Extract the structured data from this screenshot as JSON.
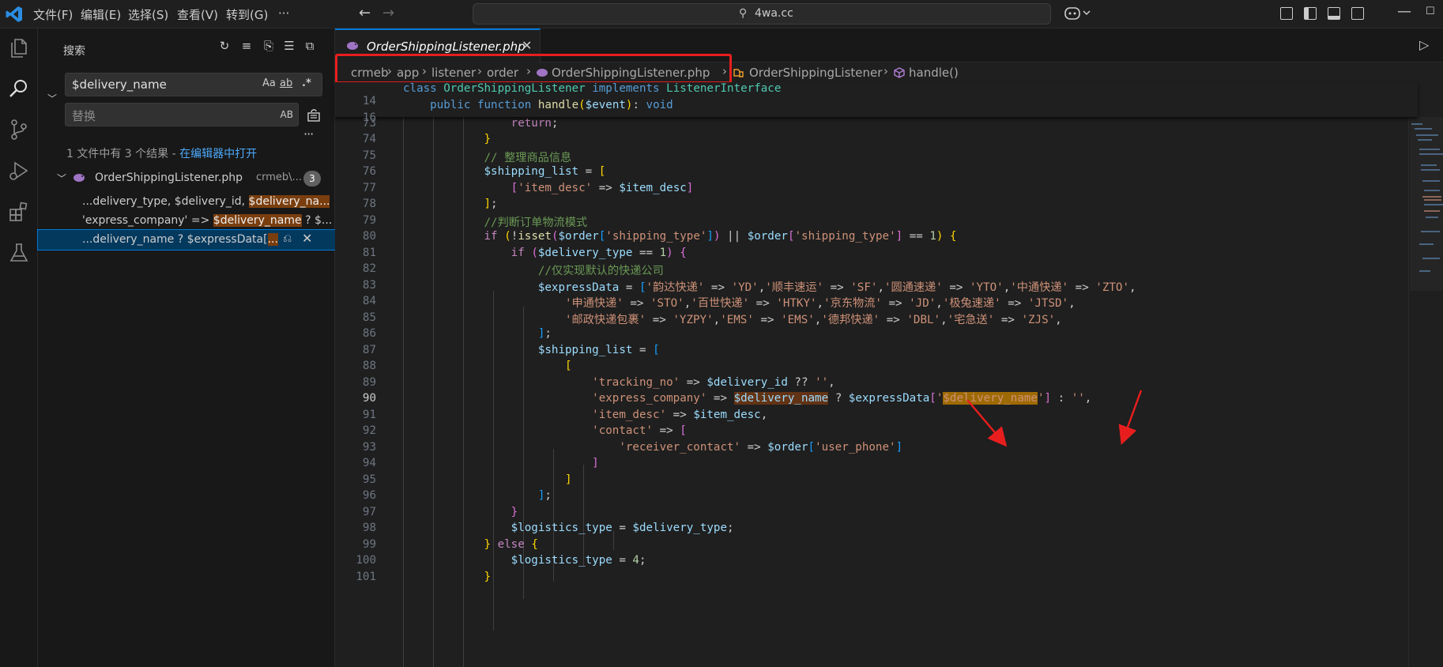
{
  "titlebar": {
    "menus": [
      "文件(F)",
      "编辑(E)",
      "选择(S)",
      "查看(V)",
      "转到(G)",
      "···"
    ],
    "command_center": "4wa.cc"
  },
  "sidebar": {
    "title": "搜索",
    "search_value": "$delivery_name",
    "replace_placeholder": "替换",
    "opt_case": "Aa",
    "opt_word": "ab",
    "opt_regex": ".*",
    "opt_preserve_case": "AB",
    "result_summary": "1 文件中有 3 个结果 - ",
    "open_in_editor": "在编辑器中打开",
    "file": {
      "name": "OrderShippingListener.php",
      "path": "crmeb\\...",
      "count": "3"
    },
    "matches": [
      {
        "pre": "...delivery_type, $delivery_id, ",
        "hit": "$delivery_na..."
      },
      {
        "pre": "'express_company' => ",
        "hit": "$delivery_name",
        "post": " ? $..."
      },
      {
        "pre": "...delivery_name ? $expressData[",
        "hit": "..."
      }
    ]
  },
  "editor": {
    "tab_label": "OrderShippingListener.php",
    "breadcrumb": [
      "crmeb",
      "app",
      "listener",
      "order",
      "OrderShippingListener.php",
      "OrderShippingListener",
      "handle()"
    ]
  },
  "code": {
    "sticky": [
      {
        "ln": "14",
        "text": "class OrderShippingListener implements ListenerInterface"
      },
      {
        "ln": "16",
        "text": "    public function handle($event): void"
      }
    ],
    "lines": [
      {
        "ln": "73",
        "text": "                return;"
      },
      {
        "ln": "74",
        "text": "            }"
      },
      {
        "ln": "75",
        "text": "            // 整理商品信息"
      },
      {
        "ln": "76",
        "text": "            $shipping_list = ["
      },
      {
        "ln": "77",
        "text": "                ['item_desc' => $item_desc]"
      },
      {
        "ln": "78",
        "text": "            ];"
      },
      {
        "ln": "79",
        "text": "            //判断订单物流模式"
      },
      {
        "ln": "80",
        "text": "            if (!isset($order['shipping_type']) || $order['shipping_type'] == 1) {"
      },
      {
        "ln": "81",
        "text": "                if ($delivery_type == 1) {"
      },
      {
        "ln": "82",
        "text": "                    //仅实现默认的快递公司"
      },
      {
        "ln": "83",
        "text": "                    $expressData = ['韵达快递' => 'YD','顺丰速运' => 'SF','圆通速递' => 'YTO','中通快递' => 'ZTO',"
      },
      {
        "ln": "84",
        "text": "                        '申通快递' => 'STO','百世快递' => 'HTKY','京东物流' => 'JD','极兔速递' => 'JTSD',"
      },
      {
        "ln": "85",
        "text": "                        '邮政快递包裹' => 'YZPY','EMS' => 'EMS','德邦快递' => 'DBL','宅急送' => 'ZJS',"
      },
      {
        "ln": "86",
        "text": "                    ];"
      },
      {
        "ln": "87",
        "text": "                    $shipping_list = ["
      },
      {
        "ln": "88",
        "text": "                        ["
      },
      {
        "ln": "89",
        "text": "                            'tracking_no' => $delivery_id ?? '',"
      },
      {
        "ln": "90",
        "text": "                            'express_company' => $delivery_name ? $expressData['$delivery_name'] : '',"
      },
      {
        "ln": "91",
        "text": "                            'item_desc' => $item_desc,"
      },
      {
        "ln": "92",
        "text": "                            'contact' => ["
      },
      {
        "ln": "93",
        "text": "                                'receiver_contact' => $order['user_phone']"
      },
      {
        "ln": "94",
        "text": "                            ]"
      },
      {
        "ln": "95",
        "text": "                        ]"
      },
      {
        "ln": "96",
        "text": "                    ];"
      },
      {
        "ln": "97",
        "text": "                }"
      },
      {
        "ln": "98",
        "text": "                $logistics_type = $delivery_type;"
      },
      {
        "ln": "99",
        "text": "            } else {"
      },
      {
        "ln": "100",
        "text": "                $logistics_type = 4;"
      },
      {
        "ln": "101",
        "text": "            }"
      }
    ]
  },
  "colors": {
    "accent": "#0078d4",
    "annotation_red": "#e81e1e",
    "match_highlight": "#9e6a03"
  },
  "icons": [
    "vscode-logo-icon",
    "explorer-icon",
    "search-icon",
    "source-control-icon",
    "run-debug-icon",
    "extensions-icon",
    "testing-icon",
    "php-elephant-icon",
    "refresh-icon",
    "clear-icon",
    "new-search-editor-icon",
    "collapse-icon",
    "expand-icon",
    "copilot-icon",
    "layout-icon",
    "run-icon",
    "symbol-class-icon",
    "symbol-method-icon"
  ]
}
